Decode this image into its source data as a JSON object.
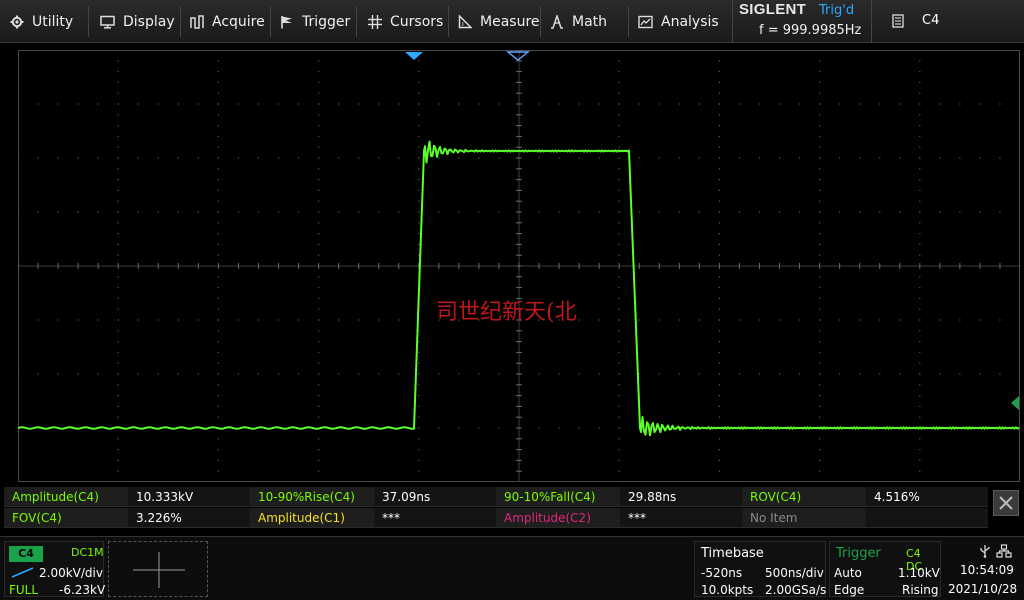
{
  "menu": [
    {
      "id": "utility",
      "label": "Utility",
      "icon": "gear-icon"
    },
    {
      "id": "display",
      "label": "Display",
      "icon": "monitor-icon"
    },
    {
      "id": "acquire",
      "label": "Acquire",
      "icon": "waveform-icon"
    },
    {
      "id": "trigger",
      "label": "Trigger",
      "icon": "flag-icon"
    },
    {
      "id": "cursors",
      "label": "Cursors",
      "icon": "crosshair-icon"
    },
    {
      "id": "measure",
      "label": "Measure",
      "icon": "ruler-icon"
    },
    {
      "id": "math",
      "label": "Math",
      "icon": "math-icon"
    },
    {
      "id": "analysis",
      "label": "Analysis",
      "icon": "analysis-icon"
    }
  ],
  "brand": {
    "name": "SIGLENT",
    "trig_status": "Trig'd",
    "frequency": "f = 999.9985Hz"
  },
  "channel_selector": {
    "label": "C4",
    "icon": "document-list-icon"
  },
  "watermark": "司世纪新天(北",
  "measurements": [
    [
      {
        "label": "Amplitude(C4)",
        "value": "10.333kV",
        "color": "#7CFC00"
      },
      {
        "label": "10-90%Rise(C4)",
        "value": "37.09ns",
        "color": "#7CFC00"
      },
      {
        "label": "90-10%Fall(C4)",
        "value": "29.88ns",
        "color": "#7CFC00"
      },
      {
        "label": "ROV(C4)",
        "value": "4.516%",
        "color": "#7CFC00"
      }
    ],
    [
      {
        "label": "FOV(C4)",
        "value": "3.226%",
        "color": "#7CFC00"
      },
      {
        "label": "Amplitude(C1)",
        "value": "***",
        "color": "#f5e027"
      },
      {
        "label": "Amplitude(C2)",
        "value": "***",
        "color": "#e0287a"
      },
      {
        "label": "No Item",
        "value": "",
        "color": "#8a8a8a"
      }
    ]
  ],
  "channel4": {
    "badge": "C4",
    "coupling": "DC1M",
    "scale": "2.00kV/div",
    "bandwidth": "FULL",
    "offset": "-6.23kV"
  },
  "timebase": {
    "title": "Timebase",
    "delay": "-520ns",
    "scale": "500ns/div",
    "points": "10.0kpts",
    "sample_rate": "2.00GSa/s"
  },
  "trigger": {
    "title": "Trigger",
    "source": "C4 DC",
    "mode": "Auto",
    "level": "1.10kV",
    "type": "Edge",
    "slope": "Rising"
  },
  "system": {
    "time": "10:54:09",
    "date": "2021/10/28",
    "icons": [
      "usb-icon",
      "network-icon"
    ]
  },
  "colors": {
    "trace": "#5cff2a",
    "grid": "#4a4a4a",
    "trigger_marker": "#2aa9ff",
    "trig_text": "#2aa9ff",
    "channel4": "#1aa34a"
  }
}
